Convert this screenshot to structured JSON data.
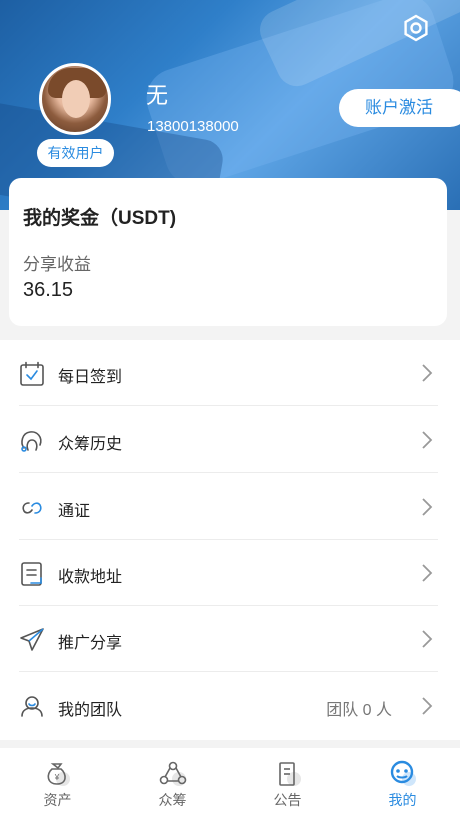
{
  "header": {
    "username": "无",
    "phone": "13800138000",
    "status_badge": "有效用户",
    "activate_label": "账户激活",
    "settings_icon": "gear-icon"
  },
  "bonus": {
    "title": "我的奖金（USDT)",
    "subtitle": "分享收益",
    "value": "36.15"
  },
  "menu": {
    "items": [
      {
        "label": "每日签到",
        "icon": "calendar-check-icon"
      },
      {
        "label": "众筹历史",
        "icon": "history-icon"
      },
      {
        "label": "通证",
        "icon": "token-link-icon"
      },
      {
        "label": "收款地址",
        "icon": "address-document-icon"
      },
      {
        "label": "推广分享",
        "icon": "paper-plane-icon"
      },
      {
        "label": "我的团队",
        "icon": "team-icon",
        "extra": "团队 0 人"
      }
    ]
  },
  "tabbar": {
    "tabs": [
      {
        "label": "资产",
        "icon": "money-bag-icon",
        "active": false
      },
      {
        "label": "众筹",
        "icon": "crowdfund-icon",
        "active": false
      },
      {
        "label": "公告",
        "icon": "notice-icon",
        "active": false
      },
      {
        "label": "我的",
        "icon": "profile-icon",
        "active": true
      }
    ]
  },
  "colors": {
    "accent": "#2a8be0",
    "header_dark": "#1d5fa3",
    "header_light": "#5ea5e6",
    "background": "#f3f3f3"
  }
}
